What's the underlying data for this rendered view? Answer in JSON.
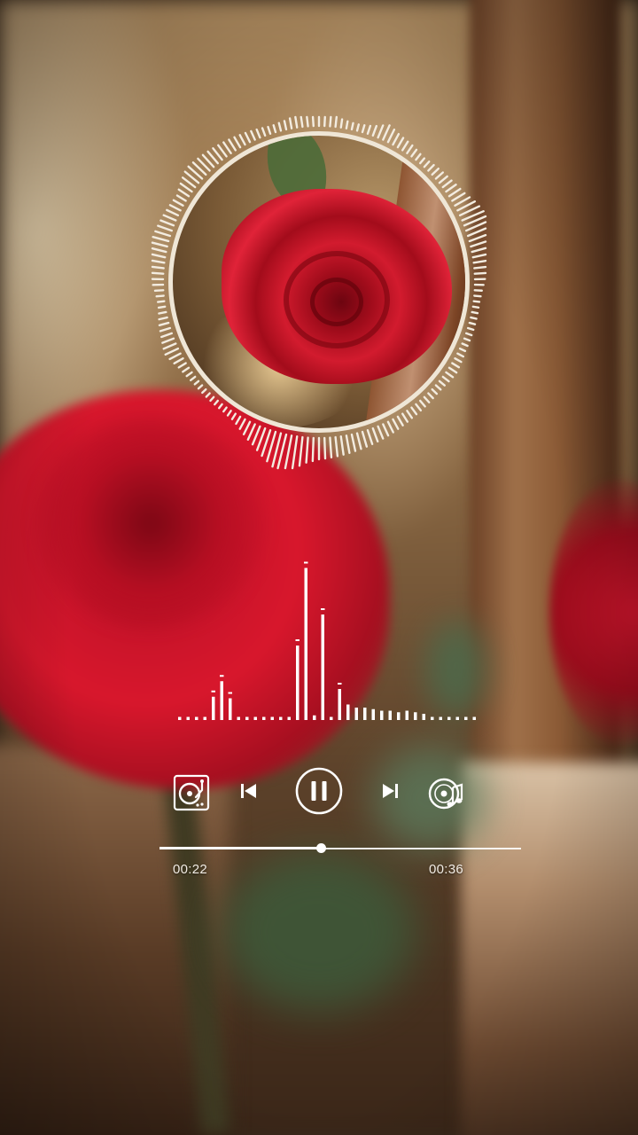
{
  "player": {
    "state": "playing",
    "elapsed": "00:22",
    "total": "00:36",
    "progress": 0.447
  },
  "controls": {
    "turntable_icon": "turntable-icon",
    "prev_icon": "skip-previous-icon",
    "play_pause_icon": "pause-icon",
    "next_icon": "skip-next-icon",
    "disc_icon": "music-disc-icon"
  },
  "album_art": {
    "subject": "red-rose-icon"
  },
  "visualizer": {
    "spectrum_levels": [
      0.02,
      0.02,
      0.02,
      0.02,
      0.15,
      0.25,
      0.14,
      0.02,
      0.02,
      0.02,
      0.02,
      0.02,
      0.02,
      0.02,
      0.48,
      0.98,
      0.03,
      0.68,
      0.02,
      0.2,
      0.1,
      0.08,
      0.08,
      0.07,
      0.06,
      0.06,
      0.05,
      0.06,
      0.05,
      0.04,
      0.02,
      0.02,
      0.02,
      0.02,
      0.02,
      0.02
    ],
    "ring_levels": [
      0.35,
      0.3,
      0.25,
      0.2,
      0.15,
      0.12,
      0.1,
      0.1,
      0.12,
      0.15,
      0.2,
      0.28,
      0.35,
      0.3,
      0.25,
      0.22,
      0.2,
      0.18,
      0.15,
      0.12,
      0.1,
      0.12,
      0.14,
      0.16,
      0.18,
      0.2,
      0.22,
      0.25,
      0.28,
      0.32,
      0.38,
      0.45,
      0.5,
      0.55,
      0.6,
      0.62,
      0.6,
      0.55,
      0.5,
      0.45,
      0.4,
      0.35,
      0.3,
      0.25,
      0.2,
      0.16,
      0.12,
      0.1,
      0.08,
      0.08,
      0.08,
      0.08,
      0.08,
      0.08,
      0.08,
      0.08,
      0.08,
      0.08,
      0.1,
      0.12,
      0.14,
      0.16,
      0.15,
      0.13,
      0.11,
      0.1,
      0.1,
      0.11,
      0.12,
      0.13,
      0.14,
      0.15,
      0.16,
      0.18,
      0.2,
      0.22,
      0.24,
      0.26,
      0.28,
      0.3,
      0.32,
      0.34,
      0.36,
      0.38,
      0.4,
      0.42,
      0.44,
      0.46,
      0.48,
      0.5,
      0.55,
      0.6,
      0.7,
      0.8,
      0.9,
      1.0,
      0.85,
      0.75,
      0.65,
      0.55,
      0.45,
      0.38,
      0.3,
      0.22,
      0.15,
      0.1,
      0.08,
      0.06,
      0.06,
      0.06,
      0.06,
      0.06,
      0.06,
      0.06,
      0.06,
      0.08,
      0.1,
      0.12,
      0.15,
      0.2,
      0.25,
      0.3,
      0.28,
      0.25,
      0.22,
      0.2,
      0.18,
      0.15,
      0.12,
      0.1,
      0.1,
      0.12,
      0.15,
      0.2,
      0.25,
      0.3,
      0.34,
      0.38,
      0.42,
      0.4,
      0.38,
      0.36,
      0.34,
      0.32,
      0.3,
      0.28,
      0.26,
      0.24,
      0.22,
      0.2,
      0.25,
      0.3,
      0.35,
      0.4,
      0.42,
      0.4,
      0.38,
      0.36,
      0.34,
      0.32,
      0.3,
      0.28,
      0.26,
      0.24,
      0.22,
      0.2,
      0.18,
      0.16,
      0.14,
      0.12,
      0.12,
      0.14,
      0.16,
      0.2,
      0.25,
      0.3,
      0.35,
      0.4
    ]
  }
}
